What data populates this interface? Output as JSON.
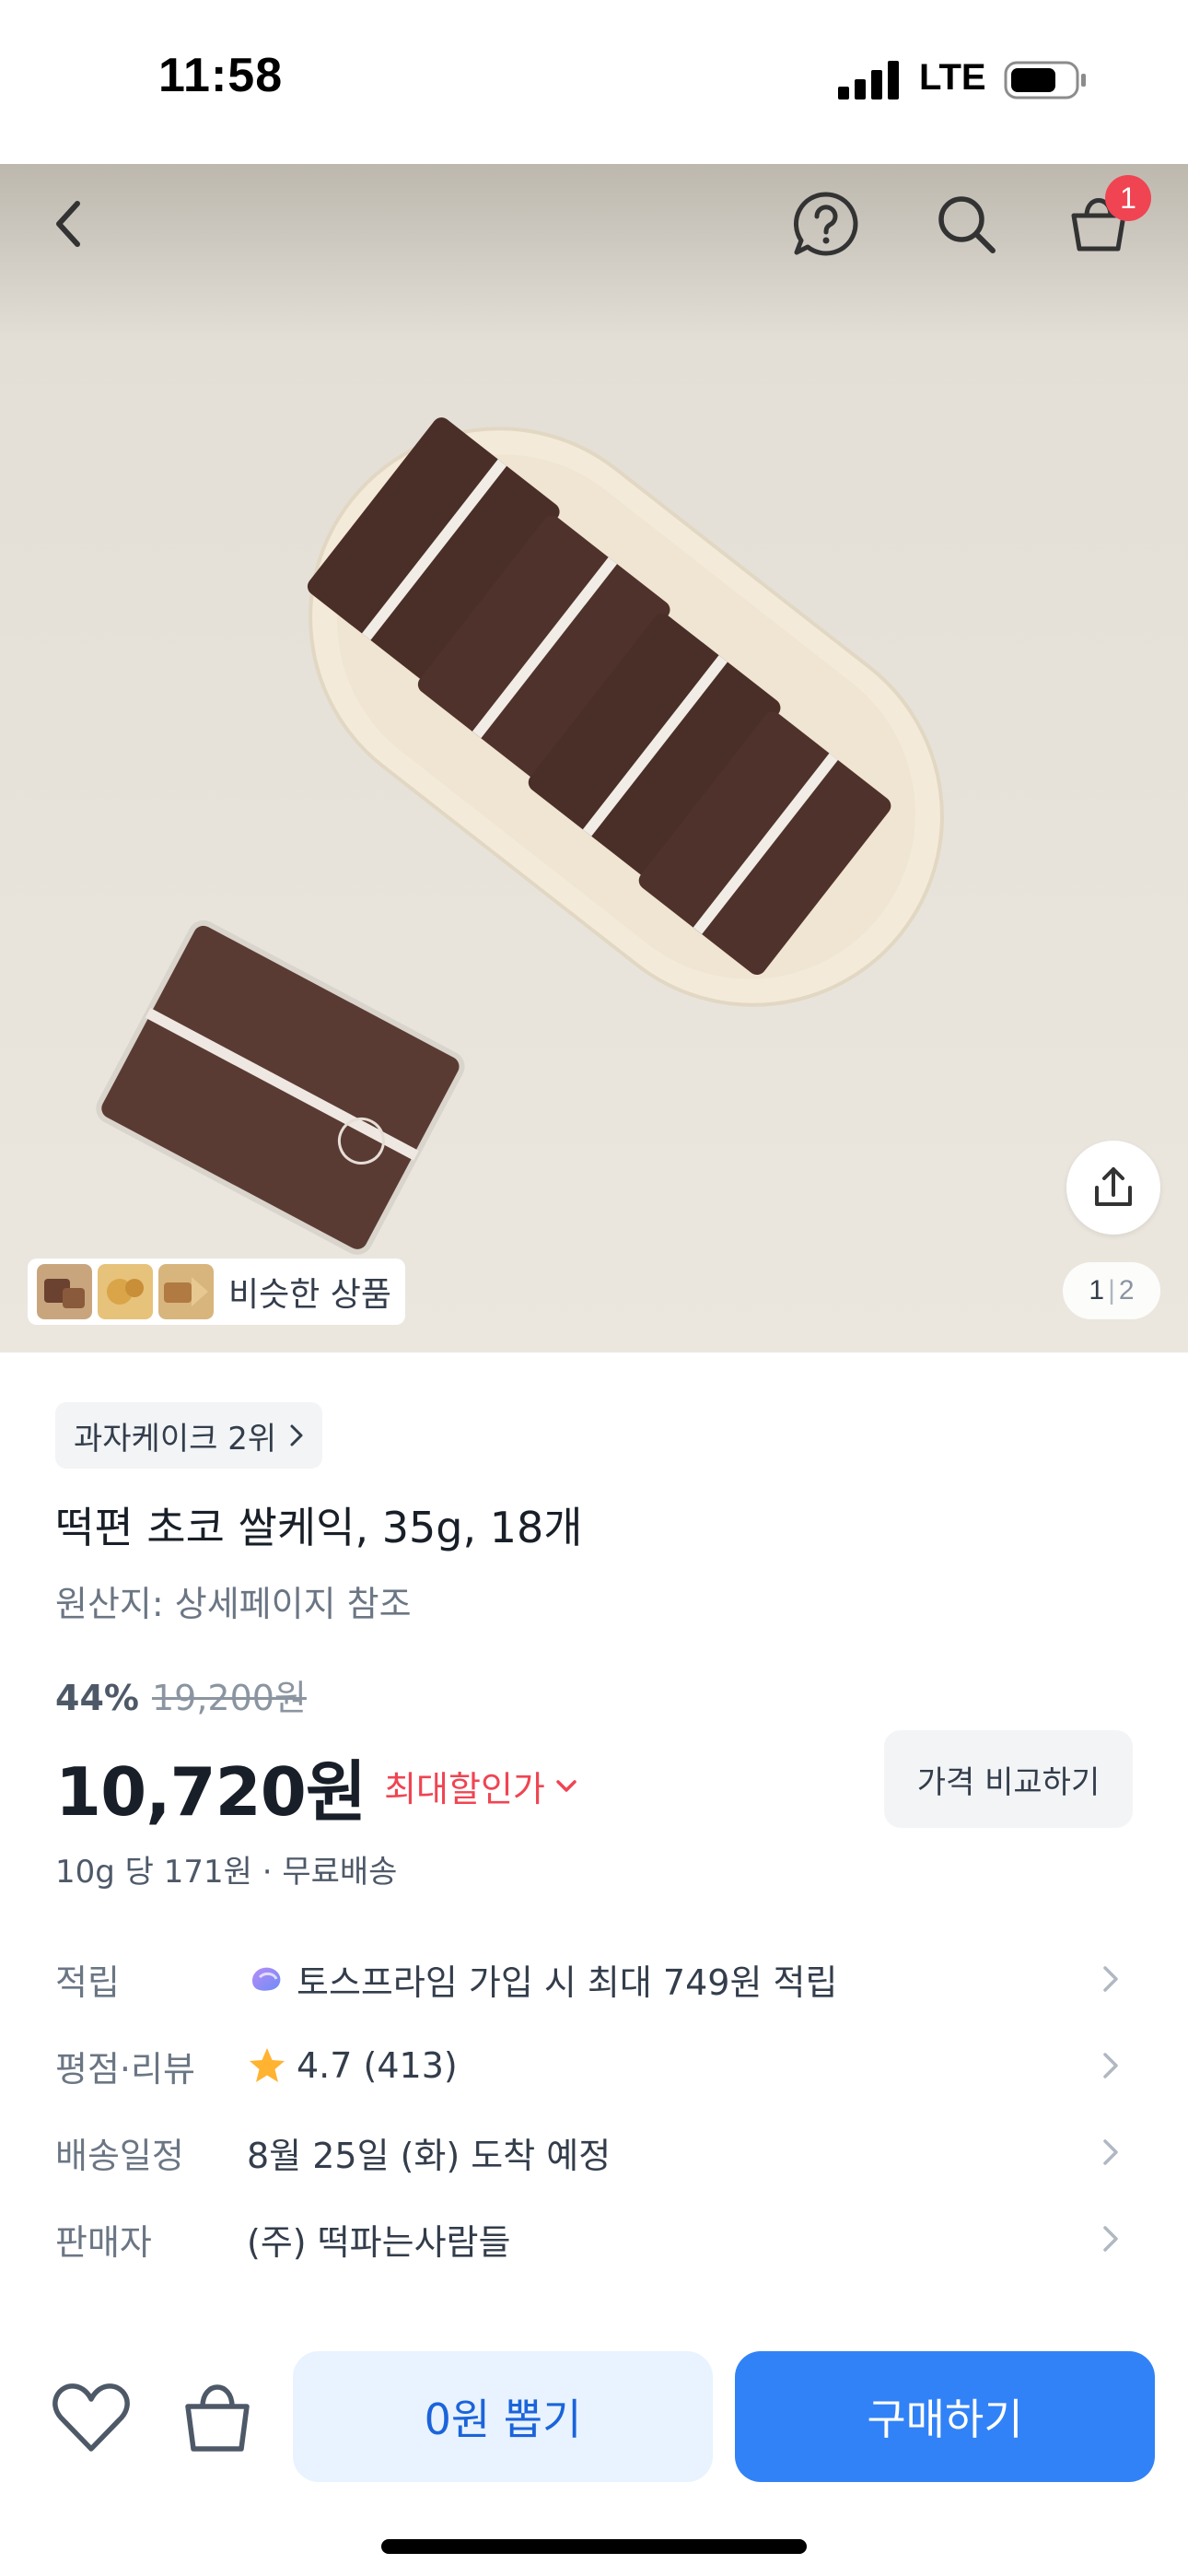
{
  "status_bar": {
    "time": "11:58",
    "network": "LTE"
  },
  "top_nav": {
    "cart_count": "1"
  },
  "gallery": {
    "similar_label": "비슷한 상품",
    "page_current": "1",
    "page_separator": "|",
    "page_total": "2"
  },
  "product": {
    "rank_label": "과자케이크 2위",
    "title": "떡편 초코 쌀케익, 35g, 18개",
    "origin": "원산지: 상세페이지 참조",
    "discount_percent": "44%",
    "original_price": "19,200원",
    "price": "10,720원",
    "max_discount_label": "최대할인가",
    "compare_label": "가격 비교하기",
    "unit_info": "10g 당 171원 · 무료배송"
  },
  "details": [
    {
      "label": "적립",
      "value": "토스프라임 가입 시 최대 749원 적립",
      "icon": "toss-prime-icon"
    },
    {
      "label": "평점·리뷰",
      "value": "4.7 (413)",
      "icon": "star-icon"
    },
    {
      "label": "배송일정",
      "value": "8월 25일 (화) 도착 예정"
    },
    {
      "label": "판매자",
      "value": "(주) 떡파는사람들"
    }
  ],
  "bottom_bar": {
    "coupon_label": "0원 뽑기",
    "buy_label": "구매하기"
  },
  "colors": {
    "accent_blue": "#3182f6",
    "discount_red": "#f04452",
    "light_blue_bg": "#e8f3ff"
  }
}
